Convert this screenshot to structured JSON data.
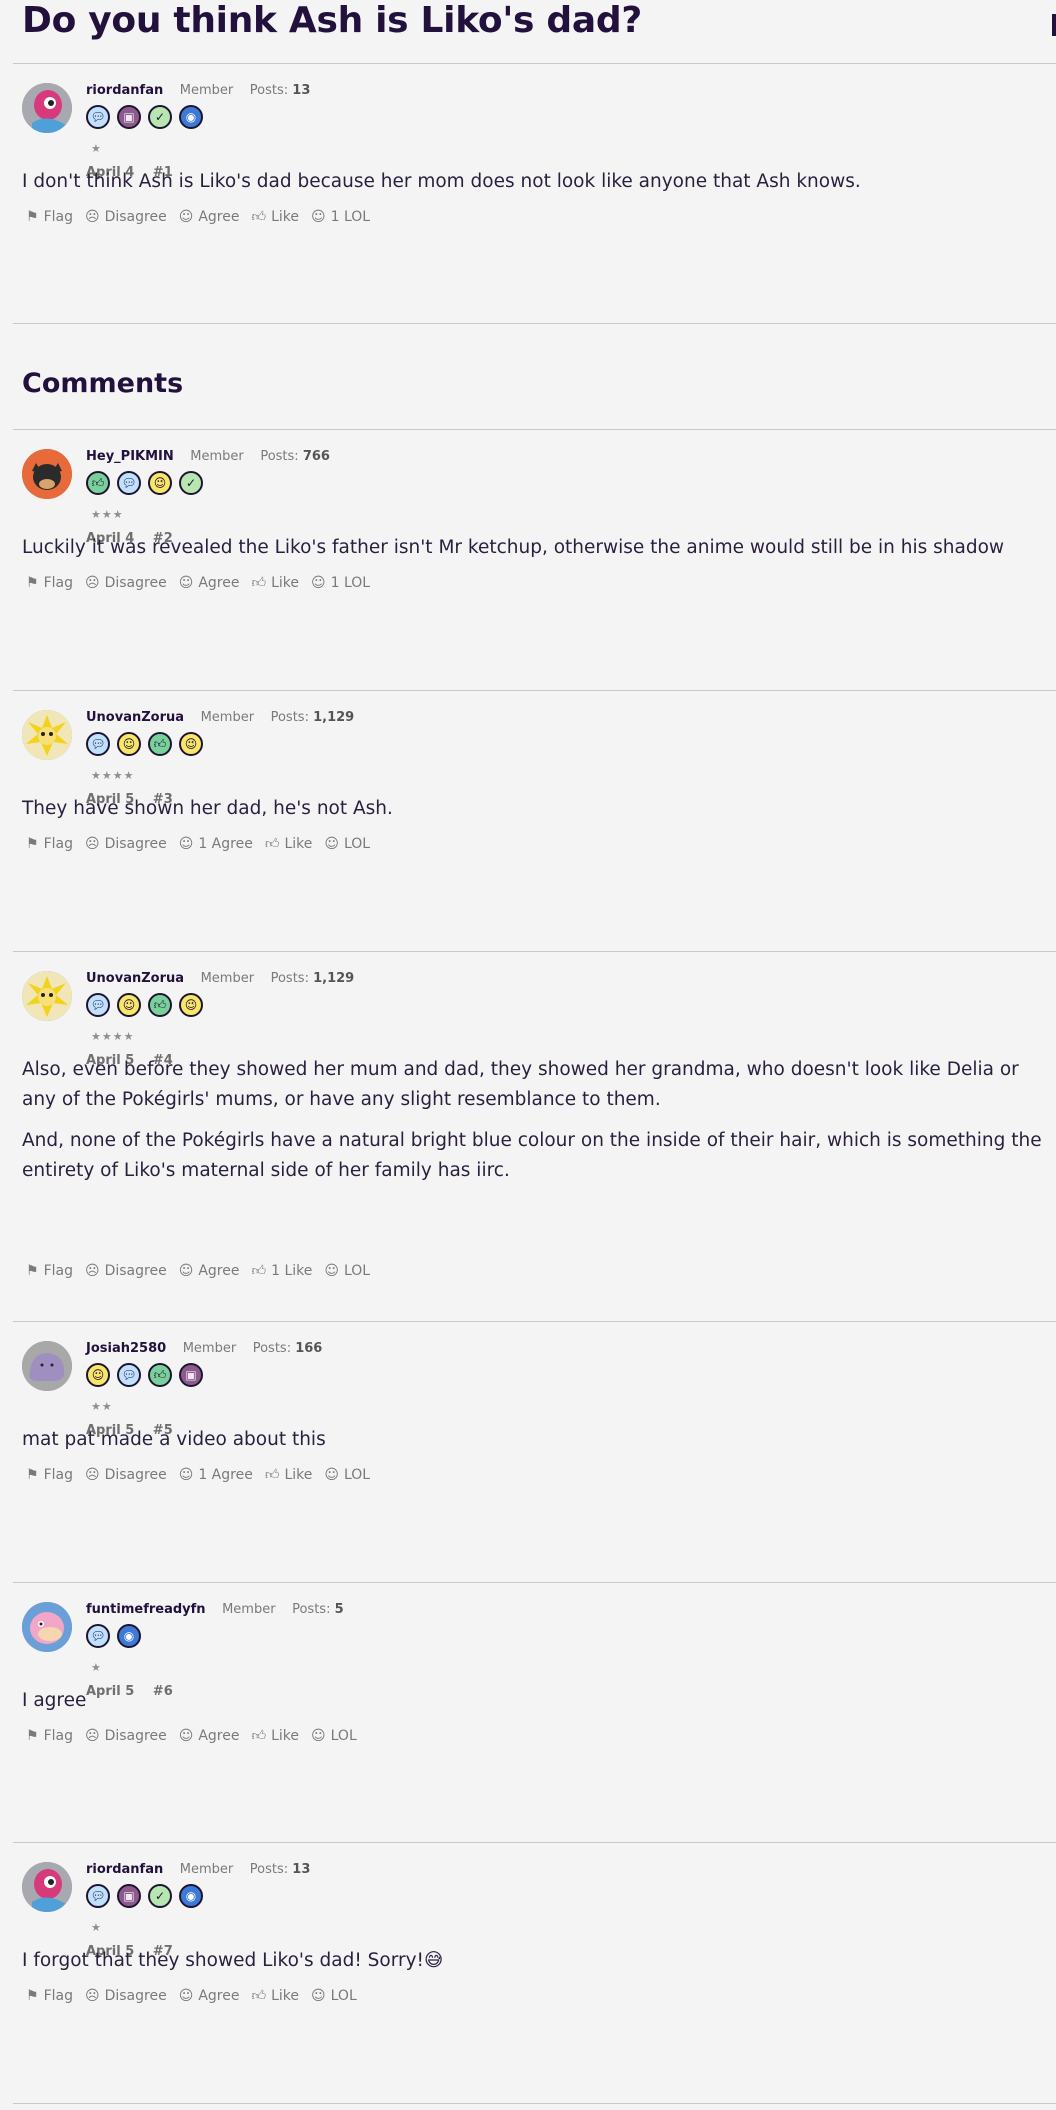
{
  "thread": {
    "title": "Do you think Ash is Liko's dad?"
  },
  "comments_heading": "Comments",
  "labels": {
    "member": "Member",
    "posts": "Posts:"
  },
  "posts": [
    {
      "author": "riordanfan",
      "role": "Member",
      "post_count": "13",
      "badges": [
        "speech-bubble-icon",
        "calendar-icon",
        "check-icon",
        "camera-icon"
      ],
      "stars": "★",
      "date": "April 4",
      "number": "#1",
      "paragraphs": [
        "I don't think Ash is Liko's dad because her mom does not look like anyone that Ash knows."
      ],
      "actions": {
        "flag": "Flag",
        "disagree": "Disagree",
        "agree": "Agree",
        "like": "Like",
        "lol": "1 LOL"
      }
    },
    {
      "author": "Hey_PIKMIN",
      "role": "Member",
      "post_count": "766",
      "badges": [
        "thumbs-up-icon",
        "speech-bubble-icon",
        "wink-icon",
        "check-icon"
      ],
      "stars": "★★★",
      "date": "April 4",
      "number": "#2",
      "paragraphs": [
        "Luckily it was revealed the Liko's father isn't Mr ketchup, otherwise the anime would still be in his shadow"
      ],
      "actions": {
        "flag": "Flag",
        "disagree": "Disagree",
        "agree": "Agree",
        "like": "Like",
        "lol": "1 LOL"
      }
    },
    {
      "author": "UnovanZorua",
      "role": "Member",
      "post_count": "1,129",
      "badges": [
        "speech-bubble-icon",
        "smile-icon",
        "thumbs-up-icon",
        "wink-icon"
      ],
      "stars": "★★★★",
      "date": "April 5",
      "number": "#3",
      "paragraphs": [
        "They have shown her dad, he's not Ash."
      ],
      "actions": {
        "flag": "Flag",
        "disagree": "Disagree",
        "agree": "1 Agree",
        "like": "Like",
        "lol": "LOL"
      }
    },
    {
      "author": "UnovanZorua",
      "role": "Member",
      "post_count": "1,129",
      "badges": [
        "speech-bubble-icon",
        "smile-icon",
        "thumbs-up-icon",
        "wink-icon"
      ],
      "stars": "★★★★",
      "date": "April 5",
      "number": "#4",
      "paragraphs": [
        "Also, even before they showed her mum and dad, they showed her grandma, who doesn't look like Delia or any of the Pokégirls' mums, or have any slight resemblance to them.",
        "And, none of the Pokégirls have a natural bright blue colour on the inside of their hair, which is something the entirety of Liko's maternal side of her family has iirc."
      ],
      "actions": {
        "flag": "Flag",
        "disagree": "Disagree",
        "agree": "Agree",
        "like": "1 Like",
        "lol": "LOL"
      }
    },
    {
      "author": "Josiah2580",
      "role": "Member",
      "post_count": "166",
      "badges": [
        "smile-icon",
        "speech-bubble-icon",
        "thumbs-up-icon",
        "calendar-icon"
      ],
      "stars": "★★",
      "date": "April 5",
      "number": "#5",
      "paragraphs": [
        "mat pat made a video about this"
      ],
      "actions": {
        "flag": "Flag",
        "disagree": "Disagree",
        "agree": "1 Agree",
        "like": "Like",
        "lol": "LOL"
      }
    },
    {
      "author": "funtimefreadyfn",
      "role": "Member",
      "post_count": "5",
      "badges": [
        "speech-bubble-icon",
        "camera-icon"
      ],
      "stars": "★",
      "date": "April 5",
      "number": "#6",
      "paragraphs": [
        "I agree"
      ],
      "actions": {
        "flag": "Flag",
        "disagree": "Disagree",
        "agree": "Agree",
        "like": "Like",
        "lol": "LOL"
      }
    },
    {
      "author": "riordanfan",
      "role": "Member",
      "post_count": "13",
      "badges": [
        "speech-bubble-icon",
        "calendar-icon",
        "check-icon",
        "camera-icon"
      ],
      "stars": "★",
      "date": "April 5",
      "number": "#7",
      "paragraphs": [
        "I forgot that they showed Liko's dad! Sorry!😅"
      ],
      "actions": {
        "flag": "Flag",
        "disagree": "Disagree",
        "agree": "Agree",
        "like": "Like",
        "lol": "LOL"
      }
    }
  ],
  "colors": {
    "accent": "#22113d",
    "muted": "#7a7a7a",
    "background": "#f4f4f4"
  }
}
